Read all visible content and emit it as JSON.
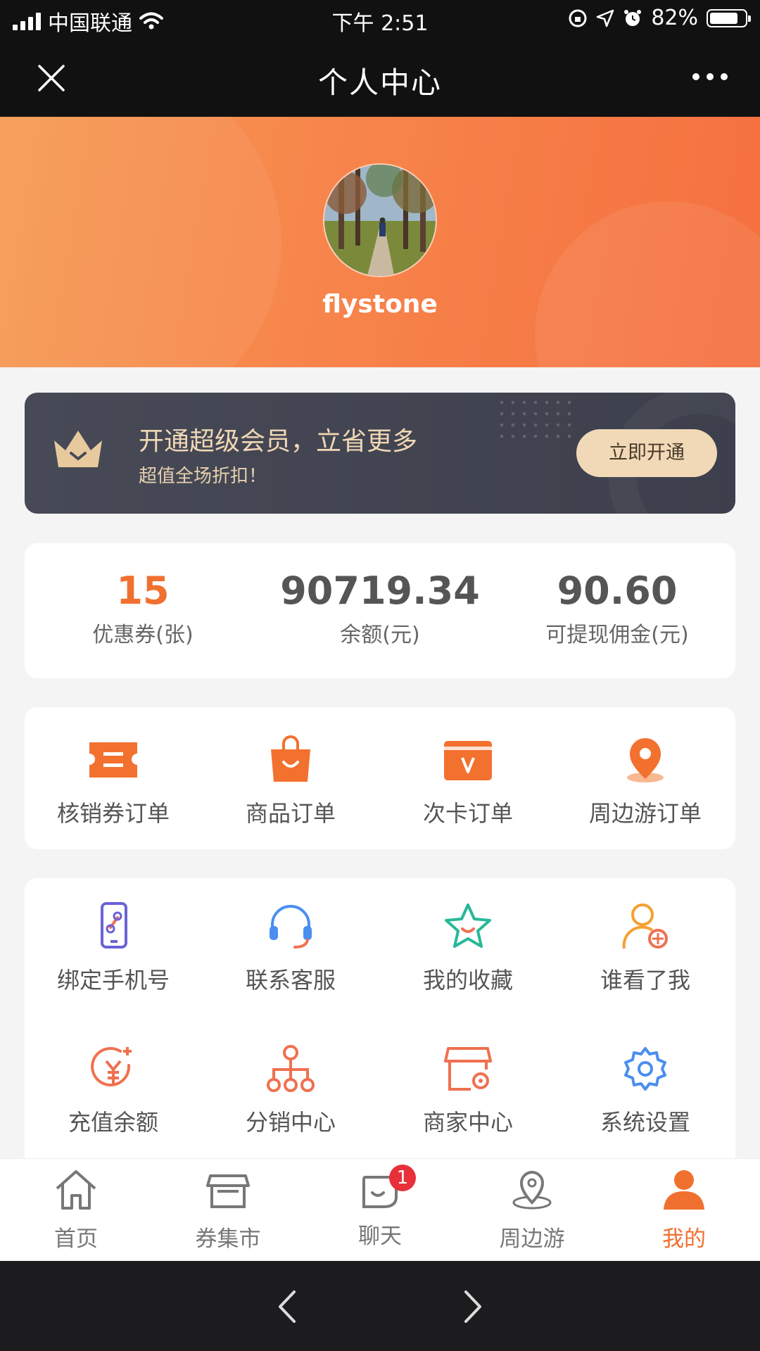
{
  "status_bar": {
    "carrier": "中国联通",
    "time": "下午 2:51",
    "battery": "82%",
    "battery_level": 0.82
  },
  "title_bar": {
    "title": "个人中心"
  },
  "profile": {
    "username": "flystone"
  },
  "vip": {
    "title": "开通超级会员，立省更多",
    "subtitle": "超值全场折扣！",
    "button": "立即开通"
  },
  "stats": [
    {
      "value": "15",
      "label": "优惠券(张)"
    },
    {
      "value": "90719.34",
      "label": "余额(元)"
    },
    {
      "value": "90.60",
      "label": "可提现佣金(元)"
    }
  ],
  "orders": [
    {
      "label": "核销券订单",
      "icon": "ticket-icon"
    },
    {
      "label": "商品订单",
      "icon": "shopping-bag-icon"
    },
    {
      "label": "次卡订单",
      "icon": "card-icon"
    },
    {
      "label": "周边游订单",
      "icon": "location-pin-icon"
    }
  ],
  "services": [
    {
      "label": "绑定手机号",
      "icon": "phone-link-icon"
    },
    {
      "label": "联系客服",
      "icon": "headset-icon"
    },
    {
      "label": "我的收藏",
      "icon": "star-icon"
    },
    {
      "label": "谁看了我",
      "icon": "user-view-icon"
    },
    {
      "label": "充值余额",
      "icon": "recharge-icon"
    },
    {
      "label": "分销中心",
      "icon": "org-chart-icon"
    },
    {
      "label": "商家中心",
      "icon": "store-settings-icon"
    },
    {
      "label": "系统设置",
      "icon": "gear-icon"
    }
  ],
  "tabs": [
    {
      "label": "首页",
      "icon": "home-icon"
    },
    {
      "label": "券集市",
      "icon": "market-icon"
    },
    {
      "label": "聊天",
      "icon": "chat-icon",
      "badge": "1"
    },
    {
      "label": "周边游",
      "icon": "map-pin-icon"
    },
    {
      "label": "我的",
      "icon": "profile-icon",
      "active": true
    }
  ],
  "colors": {
    "accent": "#f0702f",
    "vip_gold": "#f1d9b7",
    "vip_bg": "#434652",
    "badge": "#e8303a"
  }
}
